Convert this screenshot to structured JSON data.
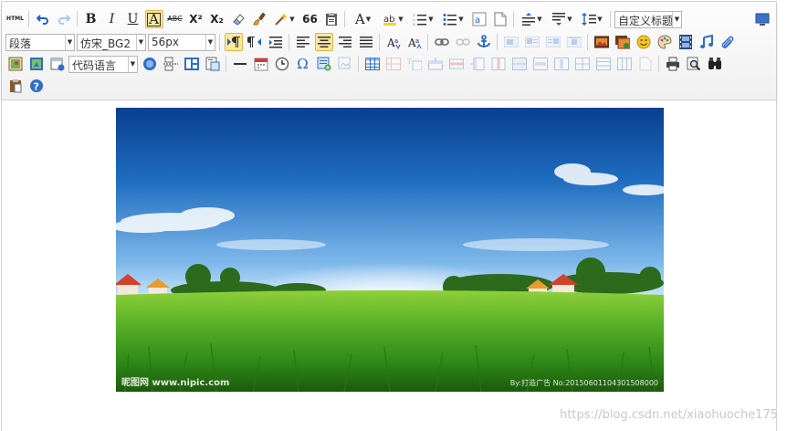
{
  "toolbar": {
    "html_button": "HTML",
    "bold": "B",
    "italic": "I",
    "underline": "U",
    "font_border": "A",
    "strikethrough": "ABC",
    "superscript": "X²",
    "subscript": "X₂",
    "quote": "66",
    "font_color": "A",
    "paragraph_format": "段落",
    "font_family": "仿宋_BG2",
    "font_size": "56px",
    "custom_title": "自定义标题",
    "code_language": "代码语言",
    "omega": "Ω"
  },
  "content": {
    "image": {
      "credit_left": "昵图网 www.nipic.com",
      "credit_right": "By:打造广告 No:20150601104301508000"
    },
    "watermark": "https://blog.csdn.net/xiaohuoche175"
  }
}
